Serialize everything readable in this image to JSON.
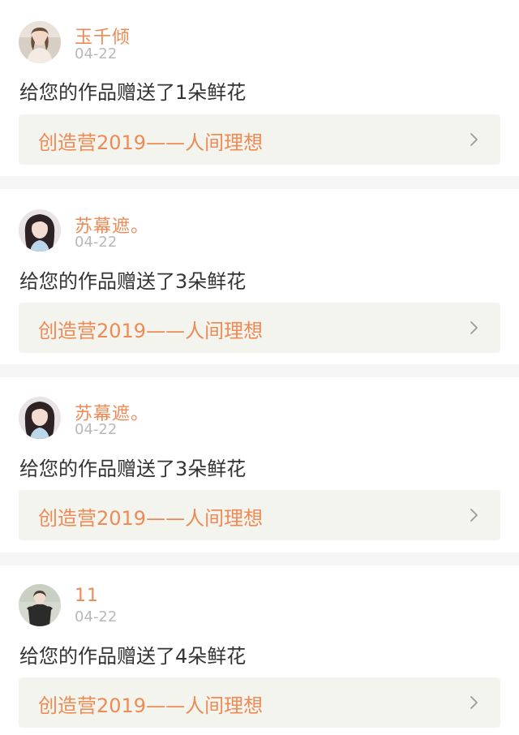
{
  "feed": {
    "items": [
      {
        "username": "玉千倾",
        "date": "04-22",
        "message": "给您的作品赠送了1朵鲜花",
        "link_label": "创造营2019——人间理想",
        "avatar_icon": "avatar-girl-beige"
      },
      {
        "username": "苏幕遮。",
        "date": "04-22",
        "message": "给您的作品赠送了3朵鲜花",
        "link_label": "创造营2019——人间理想",
        "avatar_icon": "avatar-woman-portrait"
      },
      {
        "username": "苏幕遮。",
        "date": "04-22",
        "message": "给您的作品赠送了3朵鲜花",
        "link_label": "创造营2019——人间理想",
        "avatar_icon": "avatar-woman-portrait"
      },
      {
        "username": "11",
        "date": "04-22",
        "message": "给您的作品赠送了4朵鲜花",
        "link_label": "创造营2019——人间理想",
        "avatar_icon": "avatar-girl-dark-dress"
      }
    ]
  },
  "colors": {
    "accent": "#ee8a55",
    "date": "#b8b8b8",
    "text": "#333333",
    "link_bg": "#f4f4ee",
    "divider": "#f6f6f6"
  }
}
